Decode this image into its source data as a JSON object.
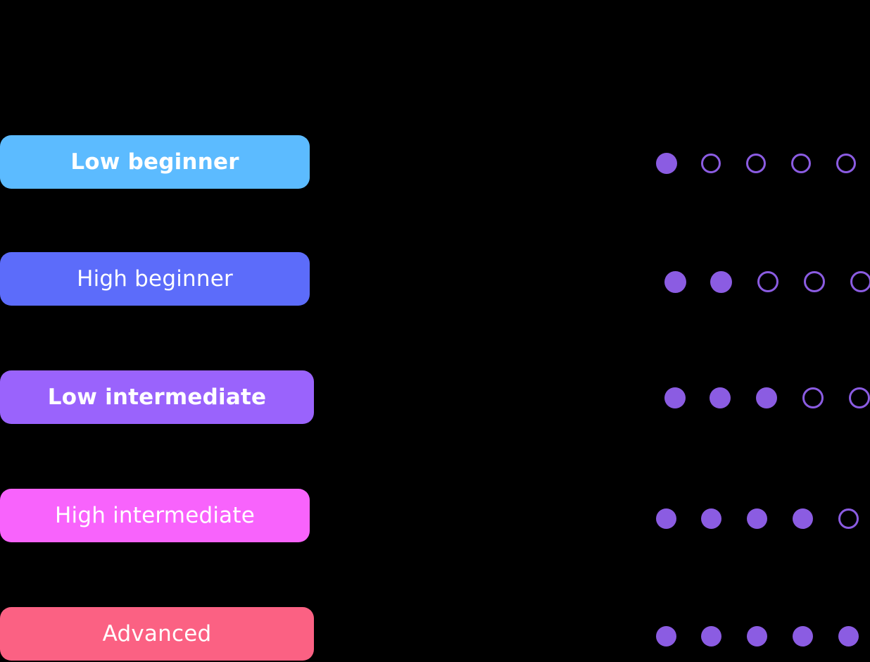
{
  "background_color": "#000000",
  "dot_color": "#8b5ce2",
  "rating_scale_max": 5,
  "levels": [
    {
      "label": "Low beginner",
      "pill_color": "#5cbbff",
      "text_color": "#ffffff",
      "bold": true,
      "rating": 1,
      "filled_dots": 1,
      "hollow_dots": 4
    },
    {
      "label": "High beginner",
      "pill_color": "#5c6cfa",
      "text_color": "#ffffff",
      "bold": false,
      "rating": 2,
      "filled_dots": 2,
      "hollow_dots": 3
    },
    {
      "label": "Low intermediate",
      "pill_color": "#9a63fc",
      "text_color": "#ffffff",
      "bold": true,
      "rating": 3,
      "filled_dots": 3,
      "hollow_dots": 2
    },
    {
      "label": "High intermediate",
      "pill_color": "#f863fc",
      "text_color": "#ffffff",
      "bold": false,
      "rating": 4,
      "filled_dots": 4,
      "hollow_dots": 1
    },
    {
      "label": "Advanced",
      "pill_color": "#fb6183",
      "text_color": "#ffffff",
      "bold": false,
      "rating": 5,
      "filled_dots": 5,
      "hollow_dots": 0
    }
  ]
}
